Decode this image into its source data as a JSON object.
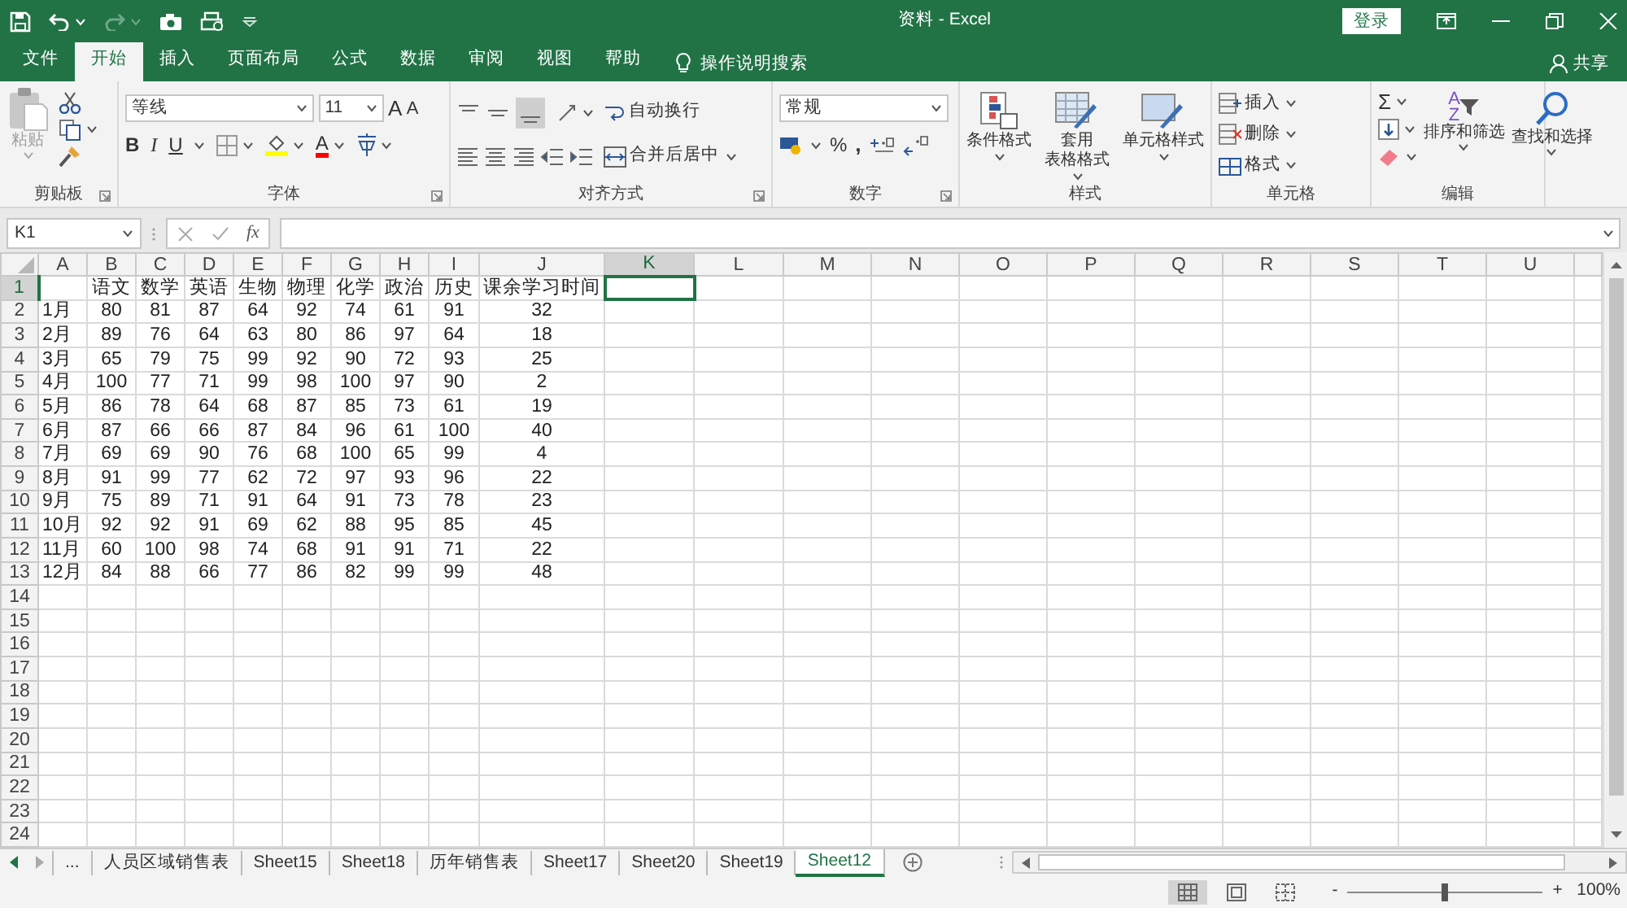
{
  "title_bar": {
    "title": "资料 - Excel",
    "login": "登录"
  },
  "menu_tabs": [
    {
      "label": "文件",
      "selected": false
    },
    {
      "label": "开始",
      "selected": true
    },
    {
      "label": "插入",
      "selected": false
    },
    {
      "label": "页面布局",
      "selected": false
    },
    {
      "label": "公式",
      "selected": false
    },
    {
      "label": "数据",
      "selected": false
    },
    {
      "label": "审阅",
      "selected": false
    },
    {
      "label": "视图",
      "selected": false
    },
    {
      "label": "帮助",
      "selected": false
    }
  ],
  "tell_me": "操作说明搜索",
  "share": "共享",
  "ribbon": {
    "clipboard": {
      "paste": "粘贴",
      "paste_disabled": true,
      "label": "剪贴板"
    },
    "font": {
      "name": "等线",
      "size": "11",
      "grow": "A",
      "shrink": "A",
      "styles": [
        "B",
        "I",
        "U"
      ],
      "color_letter": "A",
      "label": "字体"
    },
    "alignment": {
      "wrap": "自动换行",
      "merge": "合并后居中",
      "label": "对齐方式"
    },
    "number": {
      "format": "常规",
      "percent": "%",
      "comma": ",",
      "label": "数字"
    },
    "styles": {
      "buttons": [
        {
          "lines": [
            "条件格式"
          ]
        },
        {
          "lines": [
            "套用",
            "表格格式"
          ]
        },
        {
          "lines": [
            "单元格样式"
          ]
        }
      ],
      "label": "样式"
    },
    "cells": {
      "buttons": [
        "插入",
        "删除",
        "格式"
      ],
      "label": "单元格"
    },
    "editing": {
      "sum": "Σ",
      "sort_letters": [
        "A",
        "Z"
      ],
      "sort": "排序和筛选",
      "find": "查找和选择",
      "label": "编辑"
    }
  },
  "formula_bar": {
    "name_box": "K1",
    "fx": "fx"
  },
  "columns": [
    {
      "label": "A",
      "selected": false
    },
    {
      "label": "B",
      "selected": false
    },
    {
      "label": "C",
      "selected": false
    },
    {
      "label": "D",
      "selected": false
    },
    {
      "label": "E",
      "selected": false
    },
    {
      "label": "F",
      "selected": false
    },
    {
      "label": "G",
      "selected": false
    },
    {
      "label": "H",
      "selected": false
    },
    {
      "label": "I",
      "selected": false
    },
    {
      "label": "J",
      "selected": false
    },
    {
      "label": "K",
      "selected": true
    },
    {
      "label": "L",
      "selected": false
    },
    {
      "label": "M",
      "selected": false
    },
    {
      "label": "N",
      "selected": false
    },
    {
      "label": "O",
      "selected": false
    },
    {
      "label": "P",
      "selected": false
    },
    {
      "label": "Q",
      "selected": false
    },
    {
      "label": "R",
      "selected": false
    },
    {
      "label": "S",
      "selected": false
    },
    {
      "label": "T",
      "selected": false
    },
    {
      "label": "U",
      "selected": false
    }
  ],
  "row_headers": [
    {
      "label": "1",
      "selected": true
    },
    {
      "label": "2",
      "selected": false
    },
    {
      "label": "3",
      "selected": false
    },
    {
      "label": "4",
      "selected": false
    },
    {
      "label": "5",
      "selected": false
    },
    {
      "label": "6",
      "selected": false
    },
    {
      "label": "7",
      "selected": false
    },
    {
      "label": "8",
      "selected": false
    },
    {
      "label": "9",
      "selected": false
    },
    {
      "label": "10",
      "selected": false
    },
    {
      "label": "11",
      "selected": false
    },
    {
      "label": "12",
      "selected": false
    },
    {
      "label": "13",
      "selected": false
    },
    {
      "label": "14",
      "selected": false
    },
    {
      "label": "15",
      "selected": false
    },
    {
      "label": "16",
      "selected": false
    },
    {
      "label": "17",
      "selected": false
    },
    {
      "label": "18",
      "selected": false
    },
    {
      "label": "19",
      "selected": false
    },
    {
      "label": "20",
      "selected": false
    },
    {
      "label": "21",
      "selected": false
    },
    {
      "label": "22",
      "selected": false
    },
    {
      "label": "23",
      "selected": false
    },
    {
      "label": "24",
      "selected": false
    }
  ],
  "table": {
    "header": [
      "语文",
      "数学",
      "英语",
      "生物",
      "物理",
      "化学",
      "政治",
      "历史",
      "课余学习时间"
    ],
    "rows": [
      {
        "month": "1月",
        "values": [
          "80",
          "81",
          "87",
          "64",
          "92",
          "74",
          "61",
          "91",
          "32"
        ]
      },
      {
        "month": "2月",
        "values": [
          "89",
          "76",
          "64",
          "63",
          "80",
          "86",
          "97",
          "64",
          "18"
        ]
      },
      {
        "month": "3月",
        "values": [
          "65",
          "79",
          "75",
          "99",
          "92",
          "90",
          "72",
          "93",
          "25"
        ]
      },
      {
        "month": "4月",
        "values": [
          "100",
          "77",
          "71",
          "99",
          "98",
          "100",
          "97",
          "90",
          "2"
        ]
      },
      {
        "month": "5月",
        "values": [
          "86",
          "78",
          "64",
          "68",
          "87",
          "85",
          "73",
          "61",
          "19"
        ]
      },
      {
        "month": "6月",
        "values": [
          "87",
          "66",
          "66",
          "87",
          "84",
          "96",
          "61",
          "100",
          "40"
        ]
      },
      {
        "month": "7月",
        "values": [
          "69",
          "69",
          "90",
          "76",
          "68",
          "100",
          "65",
          "99",
          "4"
        ]
      },
      {
        "month": "8月",
        "values": [
          "91",
          "99",
          "77",
          "62",
          "72",
          "97",
          "93",
          "96",
          "22"
        ]
      },
      {
        "month": "9月",
        "values": [
          "75",
          "89",
          "71",
          "91",
          "64",
          "91",
          "73",
          "78",
          "23"
        ]
      },
      {
        "month": "10月",
        "values": [
          "92",
          "92",
          "91",
          "69",
          "62",
          "88",
          "95",
          "85",
          "45"
        ]
      },
      {
        "month": "11月",
        "values": [
          "60",
          "100",
          "98",
          "74",
          "68",
          "91",
          "91",
          "71",
          "22"
        ]
      },
      {
        "month": "12月",
        "values": [
          "84",
          "88",
          "66",
          "77",
          "86",
          "82",
          "99",
          "99",
          "48"
        ]
      }
    ]
  },
  "sheet_tabs": {
    "more": "...",
    "tabs": [
      {
        "label": "人员区域销售表",
        "selected": false
      },
      {
        "label": "Sheet15",
        "selected": false
      },
      {
        "label": "Sheet18",
        "selected": false
      },
      {
        "label": "历年销售表",
        "selected": false
      },
      {
        "label": "Sheet17",
        "selected": false
      },
      {
        "label": "Sheet20",
        "selected": false
      },
      {
        "label": "Sheet19",
        "selected": false
      },
      {
        "label": "Sheet12",
        "selected": true
      }
    ]
  },
  "status_bar": {
    "views": [
      {
        "selected": true
      },
      {
        "selected": false
      },
      {
        "selected": false
      }
    ],
    "zoom_out": "-",
    "zoom_in": "+",
    "zoom": {
      "level": 0.5,
      "reading": "100%"
    }
  }
}
